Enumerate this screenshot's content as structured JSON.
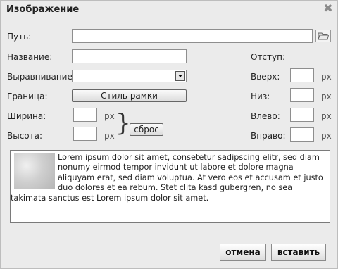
{
  "dialog": {
    "title": "Изображение",
    "close_icon": "close-icon"
  },
  "form": {
    "path_label": "Путь:",
    "path_value": "",
    "name_label": "Название:",
    "name_value": "",
    "align_label": "Выравнивание:",
    "align_value": "",
    "border_label": "Граница:",
    "border_button": "Стиль рамки",
    "width_label": "Ширина:",
    "width_value": "",
    "height_label": "Высота:",
    "height_value": "",
    "unit": "px",
    "reset_button": "сброс"
  },
  "spacing": {
    "title": "Отступ:",
    "top_label": "Вверх:",
    "bottom_label": "Низ:",
    "left_label": "Влево:",
    "right_label": "Вправо:",
    "top_value": "",
    "bottom_value": "",
    "left_value": "",
    "right_value": "",
    "unit": "px"
  },
  "preview": {
    "text": "Lorem ipsum dolor sit amet, consetetur sadipscing elitr, sed diam nonumy eirmod tempor invidunt ut labore et dolore magna aliquyam erat, sed diam voluptua. At vero eos et accusam et justo duo dolores et ea rebum. Stet clita kasd gubergren, no sea takimata sanctus est Lorem ipsum dolor sit amet."
  },
  "footer": {
    "cancel": "отмена",
    "insert": "вставить"
  }
}
